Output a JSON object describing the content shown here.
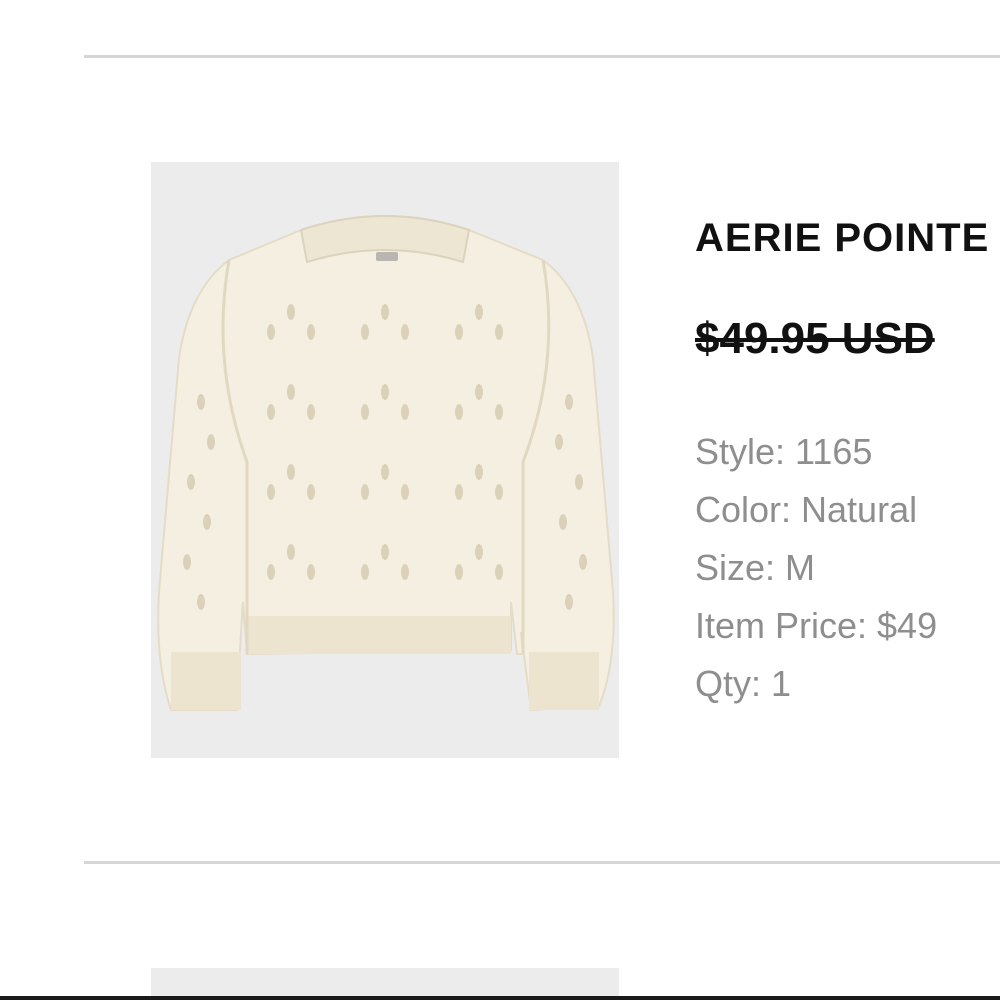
{
  "product": {
    "title": "AERIE POINTE",
    "price_original": "$49.95 USD",
    "image_alt": "sweater",
    "details": [
      {
        "label": "Style: 1165"
      },
      {
        "label": "Color: Natural"
      },
      {
        "label": "Size: M"
      },
      {
        "label": "Item Price: $49"
      },
      {
        "label": "Qty: 1"
      }
    ]
  },
  "colors": {
    "title": "#111111",
    "details": "#8e8e8e",
    "divider": "#d6d6d6",
    "image_bg": "#ececed",
    "sweater": "#f4efe0"
  }
}
